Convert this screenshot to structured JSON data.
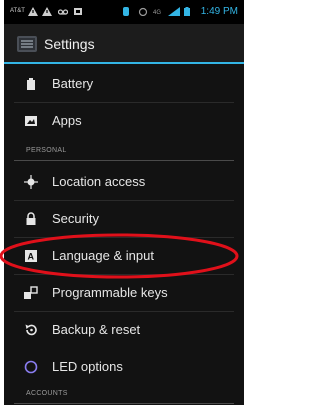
{
  "status_bar": {
    "carrier": "AT&T",
    "time": "1:49 PM",
    "icons": [
      "warning-icon",
      "warning-icon",
      "voicemail-icon",
      "screenshot-icon",
      "bluetooth-icon",
      "alarm-icon",
      "signal-icon",
      "battery-icon"
    ]
  },
  "action_bar": {
    "title": "Settings",
    "icon": "settings-app-icon"
  },
  "list": {
    "battery": "Battery",
    "apps": "Apps",
    "personal_header": "PERSONAL",
    "location": "Location access",
    "security": "Security",
    "language": "Language & input",
    "programmable": "Programmable keys",
    "backup": "Backup & reset",
    "led": "LED options",
    "accounts_header": "ACCOUNTS"
  },
  "colors": {
    "accent": "#33b5e5",
    "highlight_ring": "#e0101a",
    "background": "#121212"
  }
}
